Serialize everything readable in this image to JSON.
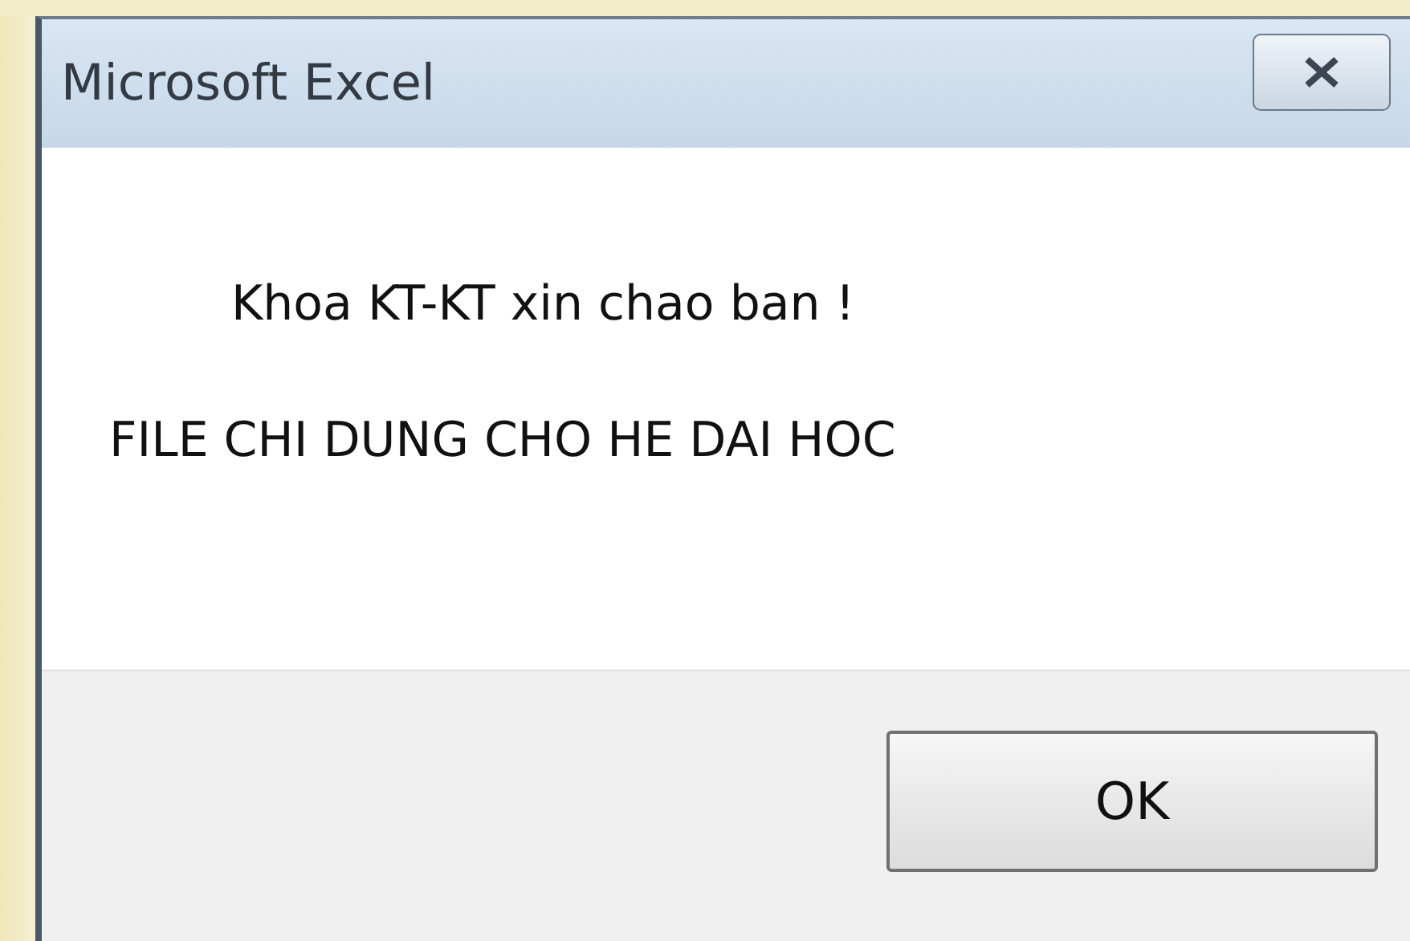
{
  "window": {
    "title": "Microsoft Excel"
  },
  "message": {
    "lines": [
      "Khoa KT-KT xin chao ban !",
      "FILE CHI DUNG CHO HE DAI HOC"
    ]
  },
  "buttons": [
    {
      "label": "OK"
    }
  ]
}
